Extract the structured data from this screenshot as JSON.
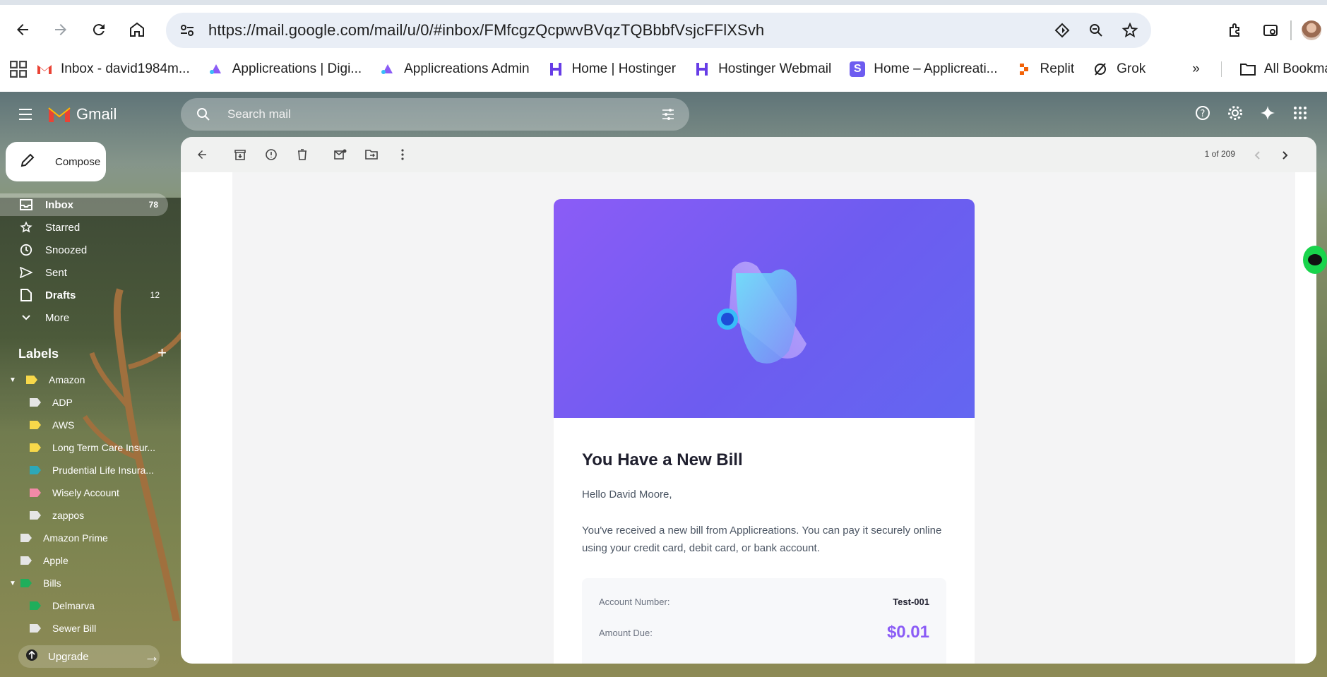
{
  "browser": {
    "url": "https://mail.google.com/mail/u/0/#inbox/FMfcgzQcpwvBVqzTQBbbfVsjcFFlXSvh",
    "bookmarks": [
      {
        "label": "Inbox - david1984m...",
        "icon": "gmail-icon"
      },
      {
        "label": "Applicreations | Digi...",
        "icon": "applicreations-icon"
      },
      {
        "label": "Applicreations Admin",
        "icon": "applicreations-icon"
      },
      {
        "label": "Home | Hostinger",
        "icon": "hostinger-icon"
      },
      {
        "label": "Hostinger Webmail",
        "icon": "hostinger-icon"
      },
      {
        "label": "Home – Applicreati...",
        "icon": "s-icon"
      },
      {
        "label": "Replit",
        "icon": "replit-icon"
      },
      {
        "label": "Grok",
        "icon": "grok-icon"
      }
    ],
    "all_bookmarks": "All Bookmarks"
  },
  "gmail": {
    "logo_text": "Gmail",
    "search_placeholder": "Search mail",
    "compose": "Compose",
    "nav": [
      {
        "label": "Inbox",
        "count": "78",
        "icon": "inbox-icon",
        "bold": true,
        "selected": true
      },
      {
        "label": "Starred",
        "count": "",
        "icon": "star-icon"
      },
      {
        "label": "Snoozed",
        "count": "",
        "icon": "clock-icon"
      },
      {
        "label": "Sent",
        "count": "",
        "icon": "send-icon"
      },
      {
        "label": "Drafts",
        "count": "12",
        "icon": "draft-icon",
        "bold": true
      },
      {
        "label": "More",
        "count": "",
        "icon": "chevron-down-icon"
      }
    ],
    "labels_title": "Labels",
    "labels": [
      {
        "label": "Amazon",
        "color": "#f7d84a",
        "indent": 0,
        "expanded": true
      },
      {
        "label": "ADP",
        "color": "#e5e5e5",
        "indent": 1
      },
      {
        "label": "AWS",
        "color": "#f7d84a",
        "indent": 1
      },
      {
        "label": "Long Term Care Insur...",
        "color": "#f7d84a",
        "indent": 1
      },
      {
        "label": "Prudential Life Insura...",
        "color": "#2da8b8",
        "indent": 1
      },
      {
        "label": "Wisely Account",
        "color": "#f28aa8",
        "indent": 1
      },
      {
        "label": "zappos",
        "color": "#e5e5e5",
        "indent": 1
      },
      {
        "label": "Amazon Prime",
        "color": "#e5e5e5",
        "indent": 0
      },
      {
        "label": "Apple",
        "color": "#e5e5e5",
        "indent": 0
      },
      {
        "label": "Bills",
        "color": "#1fae5b",
        "indent": 0,
        "expanded": true
      },
      {
        "label": "Delmarva",
        "color": "#1fae5b",
        "indent": 1
      },
      {
        "label": "Sewer Bill",
        "color": "#e5e5e5",
        "indent": 1
      }
    ],
    "upgrade": "Upgrade",
    "pager": "1 of 209"
  },
  "email": {
    "heading": "You Have a New Bill",
    "greeting": "Hello David Moore,",
    "message": "You've received a new bill from Applicreations. You can pay it securely online using your credit card, debit card, or bank account.",
    "account_label": "Account Number:",
    "account_value": "Test-001",
    "amount_label": "Amount Due:",
    "amount_value": "$0.01",
    "accent": "#8b5cf6"
  }
}
